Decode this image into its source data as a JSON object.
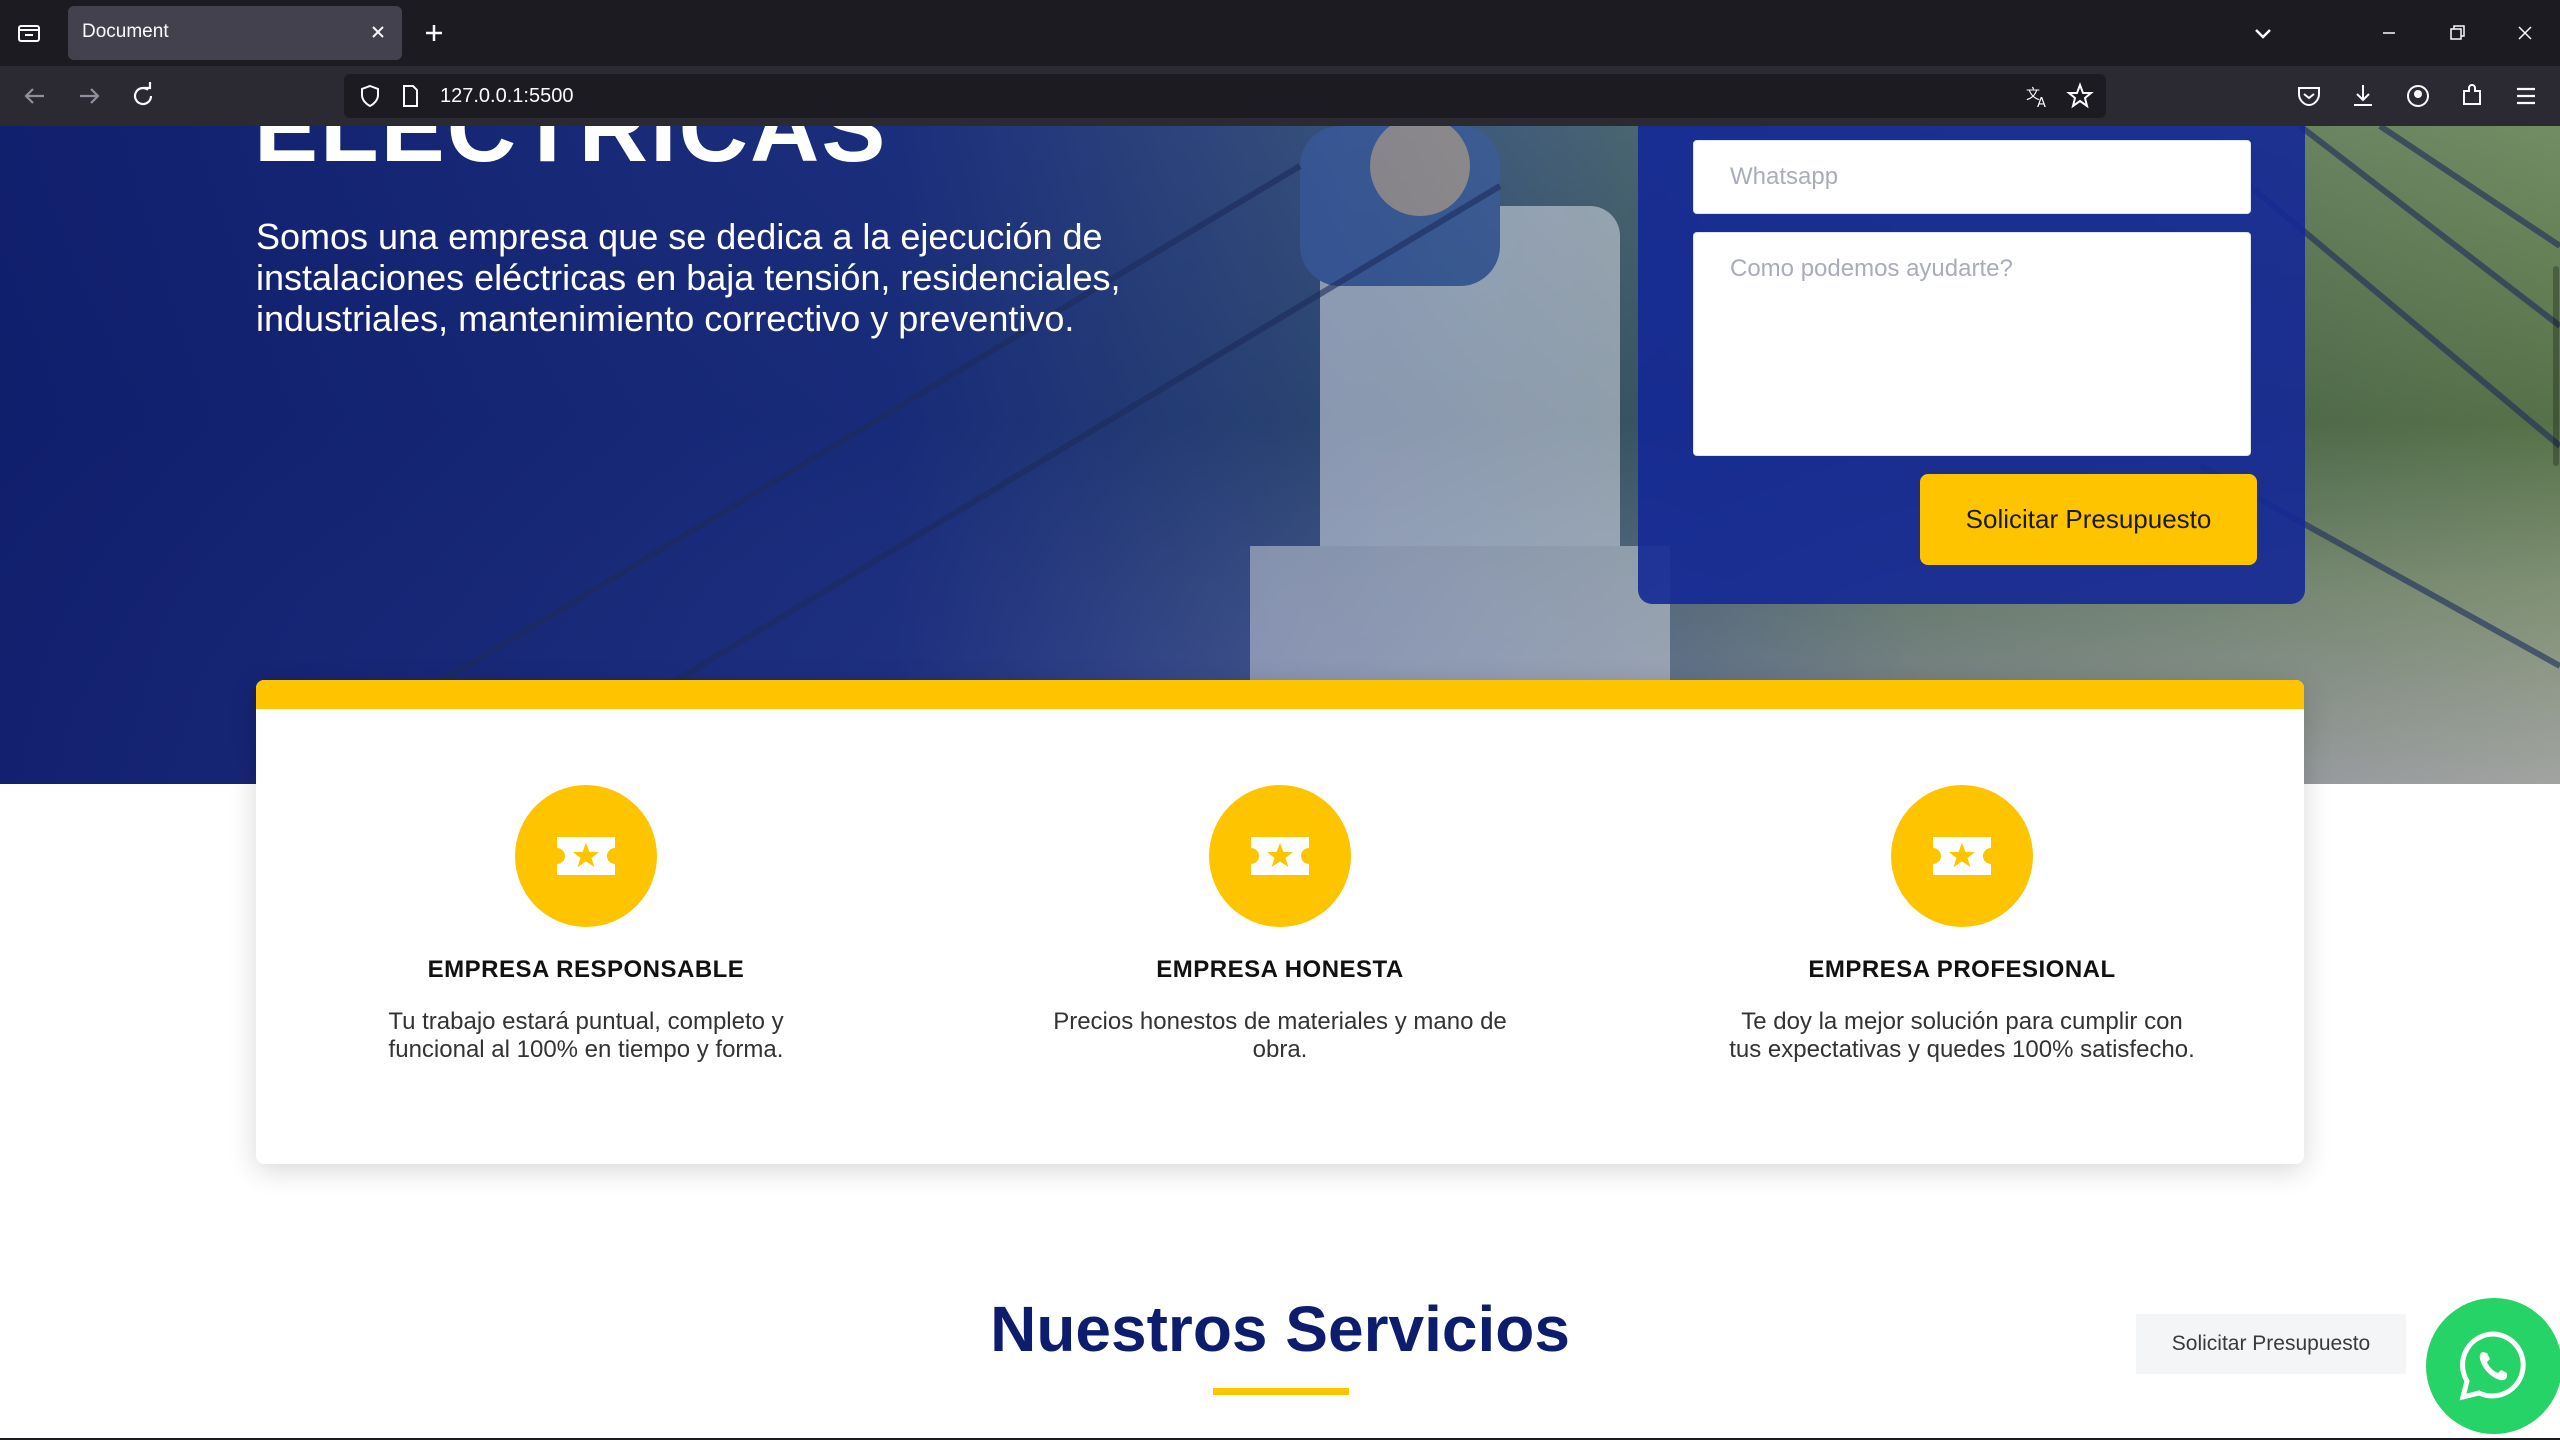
{
  "browser": {
    "tab_title": "Document",
    "url": "127.0.0.1:5500",
    "icons": [
      "tab-list-icon",
      "close-icon",
      "plus-icon",
      "chevron-down-icon",
      "minimize-icon",
      "restore-icon",
      "close-window-icon",
      "back-arrow-icon",
      "forward-arrow-icon",
      "reload-icon",
      "shield-icon",
      "page-icon",
      "translate-icon",
      "star-icon",
      "pocket-icon",
      "download-icon",
      "account-icon",
      "extensions-icon",
      "menu-icon"
    ]
  },
  "hero": {
    "heading": "ELÉCTRICAS",
    "description": "Somos una empresa que se dedica a la ejecución de instalaciones eléctricas en baja tensión, residenciales, industriales, mantenimiento correctivo y preventivo."
  },
  "form": {
    "whatsapp_placeholder": "Whatsapp",
    "message_placeholder": "Como podemos ayudarte?",
    "submit_label": "Solicitar Presupuesto"
  },
  "features": [
    {
      "title": "EMPRESA RESPONSABLE",
      "description": "Tu trabajo estará puntual, completo y funcional al 100% en tiempo y forma.",
      "icon": "ticket-star-icon"
    },
    {
      "title": "EMPRESA HONESTA",
      "description": "Precios honestos de materiales y mano de obra.",
      "icon": "ticket-star-icon"
    },
    {
      "title": "EMPRESA PROFESIONAL",
      "description": "Te doy la mejor solución para cumplir con tus expectativas y quedes 100% satisfecho.",
      "icon": "ticket-star-icon"
    }
  ],
  "services": {
    "title": "Nuestros Servicios"
  },
  "floating": {
    "quote_label": "Solicitar Presupuesto",
    "whatsapp_icon": "whatsapp-icon"
  },
  "colors": {
    "brand_navy": "#0e1c6e",
    "accent_yellow": "#ffc400",
    "whatsapp_green": "#25d366"
  }
}
